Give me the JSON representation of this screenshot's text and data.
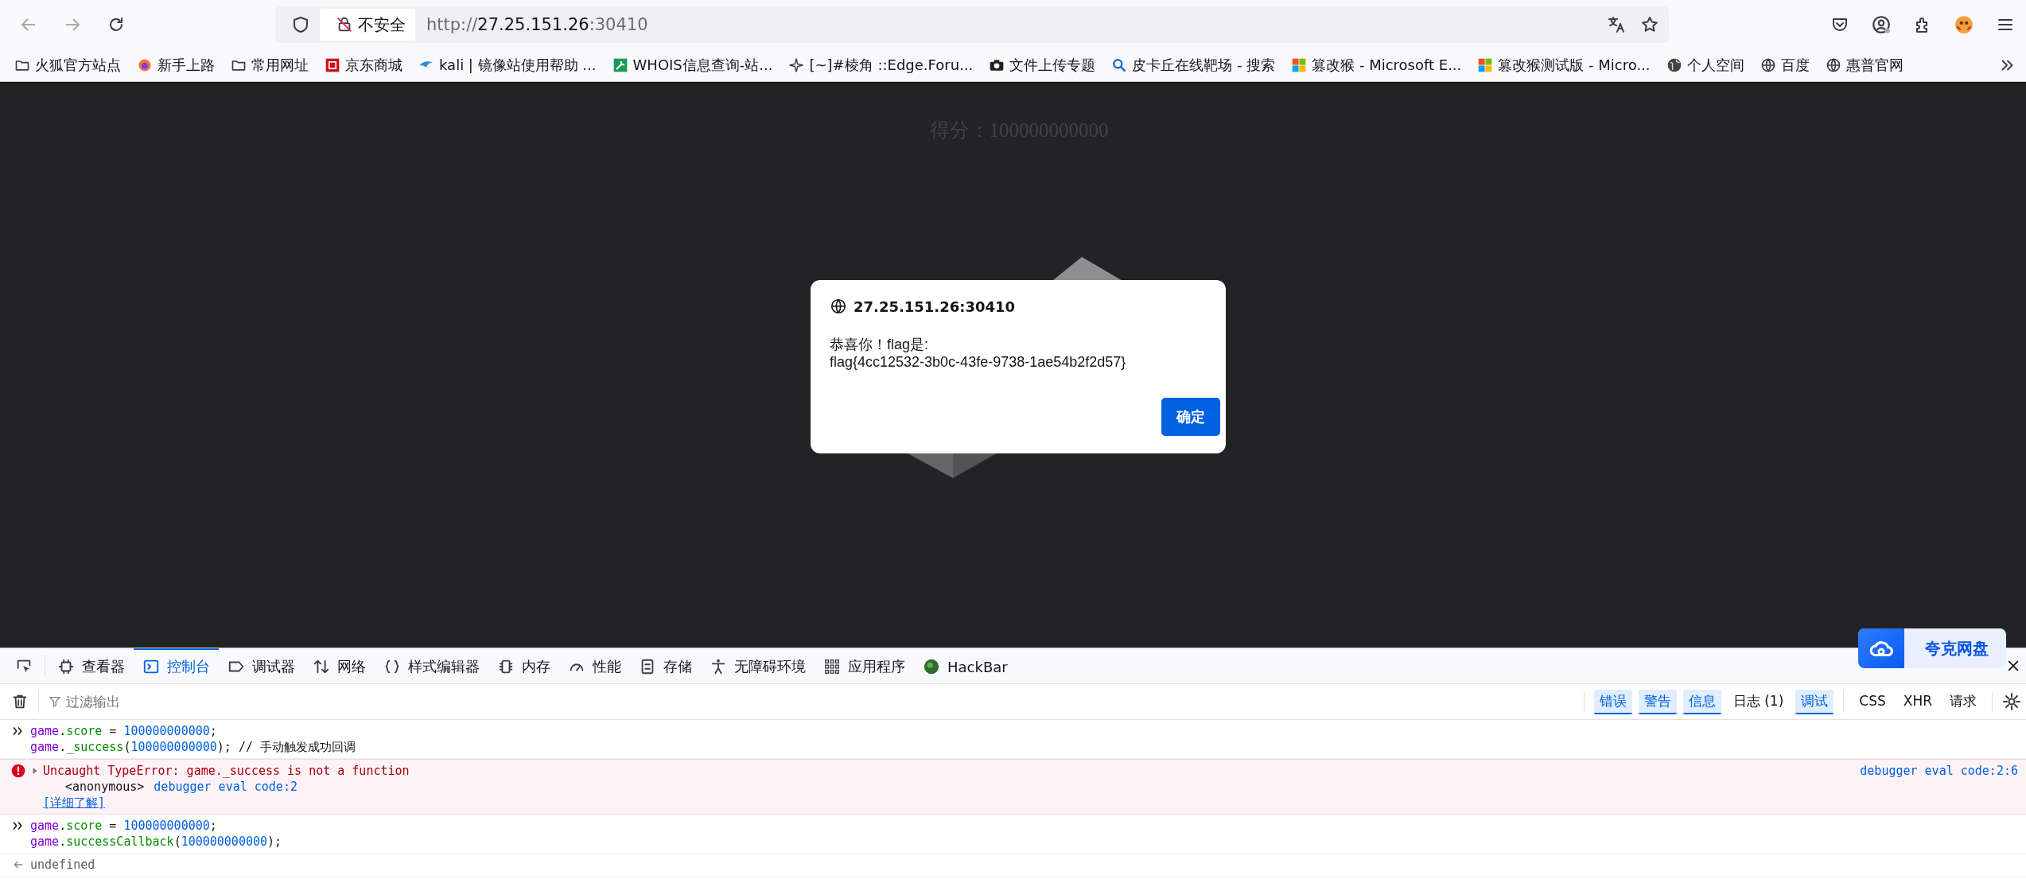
{
  "toolbar": {
    "security": {
      "label": "不安全"
    },
    "url": {
      "scheme": "http://",
      "host": "27.25.151.26",
      "port": ":30410"
    }
  },
  "bookmarks": [
    {
      "label": "火狐官方站点",
      "kind": "folder"
    },
    {
      "label": "新手上路",
      "kind": "firefox"
    },
    {
      "label": "常用网址",
      "kind": "folder"
    },
    {
      "label": "京东商城",
      "kind": "jd"
    },
    {
      "label": "kali | 镜像站使用帮助 ...",
      "kind": "kali"
    },
    {
      "label": "WHOIS信息查询-站...",
      "kind": "whois"
    },
    {
      "label": "[~]#棱角 ::Edge.Foru...",
      "kind": "star"
    },
    {
      "label": "文件上传专题",
      "kind": "camera"
    },
    {
      "label": "皮卡丘在线靶场 - 搜索",
      "kind": "search"
    },
    {
      "label": "篡改猴 - Microsoft E...",
      "kind": "windows"
    },
    {
      "label": "篡改猴测试版 - Micro...",
      "kind": "windows"
    },
    {
      "label": "个人空间",
      "kind": "globe-dark"
    },
    {
      "label": "百度",
      "kind": "globe"
    },
    {
      "label": "惠普官网",
      "kind": "globe"
    }
  ],
  "page": {
    "score_text": "得分：100000000000"
  },
  "dialog": {
    "host": "27.25.151.26:30410",
    "message_lines": [
      "恭喜你！flag是:",
      "flag{4cc12532-3b0c-43fe-9738-1ae54b2f2d57}"
    ],
    "ok_button": "确定"
  },
  "floating_badge": {
    "label": "夸克网盘"
  },
  "devtools": {
    "tabs": [
      {
        "kind": "pick",
        "selected": false
      },
      {
        "kind": "inspector",
        "label": "查看器",
        "selected": false
      },
      {
        "kind": "console",
        "label": "控制台",
        "selected": true
      },
      {
        "kind": "debugger",
        "label": "调试器",
        "selected": false
      },
      {
        "kind": "network",
        "label": "网络",
        "selected": false
      },
      {
        "kind": "style",
        "label": "样式编辑器",
        "selected": false
      },
      {
        "kind": "memory",
        "label": "内存",
        "selected": false
      },
      {
        "kind": "performance",
        "label": "性能",
        "selected": false
      },
      {
        "kind": "storage",
        "label": "存储",
        "selected": false
      },
      {
        "kind": "accessibility",
        "label": "无障碍环境",
        "selected": false
      },
      {
        "kind": "application",
        "label": "应用程序",
        "selected": false
      },
      {
        "kind": "hackbar",
        "label": "HackBar",
        "selected": false
      }
    ],
    "filter": {
      "placeholder": "过滤输出"
    },
    "level_filters": [
      {
        "label": "错误",
        "selected": true
      },
      {
        "label": "警告",
        "selected": true
      },
      {
        "label": "信息",
        "selected": true
      },
      {
        "label": "日志 (1)",
        "selected": false
      },
      {
        "label": "调试",
        "selected": true
      }
    ],
    "type_filters": [
      {
        "label": "CSS",
        "selected": false
      },
      {
        "label": "XHR",
        "selected": false
      },
      {
        "label": "请求",
        "selected": false
      }
    ],
    "console": [
      {
        "kind": "input",
        "lines": [
          [
            {
              "t": "game",
              "kind": "var"
            },
            {
              "t": ".",
              "kind": "plain"
            },
            {
              "t": "score",
              "kind": "prop"
            },
            {
              "t": " = ",
              "kind": "plain"
            },
            {
              "t": "100000000000",
              "kind": "num"
            },
            {
              "t": ";",
              "kind": "plain"
            }
          ],
          [
            {
              "t": "game",
              "kind": "var"
            },
            {
              "t": ".",
              "kind": "plain"
            },
            {
              "t": "_success",
              "kind": "prop"
            },
            {
              "t": "(",
              "kind": "plain"
            },
            {
              "t": "100000000000",
              "kind": "num"
            },
            {
              "t": "); ",
              "kind": "plain"
            },
            {
              "t": "// 手动触发成功回调",
              "kind": "comment"
            }
          ]
        ]
      },
      {
        "kind": "error",
        "expanded": false,
        "message": "Uncaught TypeError: game._success is not a function",
        "frame": {
          "name": "<anonymous>",
          "location": "debugger eval code:2"
        },
        "learn_more": "[详细了解]",
        "source": "debugger eval code:2:6"
      },
      {
        "kind": "input",
        "lines": [
          [
            {
              "t": "game",
              "kind": "var"
            },
            {
              "t": ".",
              "kind": "plain"
            },
            {
              "t": "score",
              "kind": "prop"
            },
            {
              "t": " = ",
              "kind": "plain"
            },
            {
              "t": "100000000000",
              "kind": "num"
            },
            {
              "t": ";",
              "kind": "plain"
            }
          ],
          [
            {
              "t": "game",
              "kind": "var"
            },
            {
              "t": ".",
              "kind": "plain"
            },
            {
              "t": "successCallback",
              "kind": "prop"
            },
            {
              "t": "(",
              "kind": "plain"
            },
            {
              "t": "100000000000",
              "kind": "num"
            },
            {
              "t": ");",
              "kind": "plain"
            }
          ]
        ]
      },
      {
        "kind": "result",
        "text": "undefined"
      }
    ]
  }
}
